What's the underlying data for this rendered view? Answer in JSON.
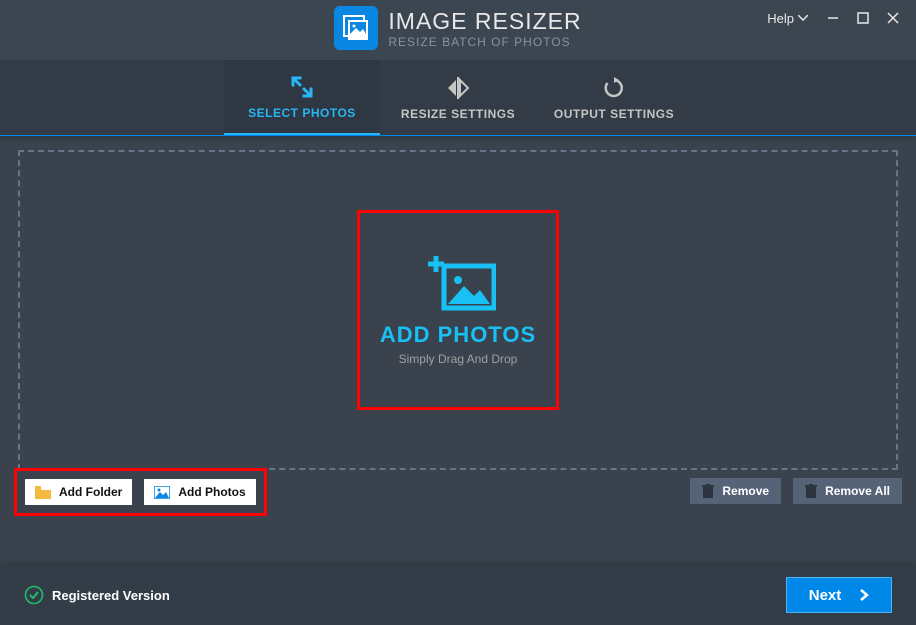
{
  "header": {
    "app_title": "IMAGE RESIZER",
    "app_subtitle": "RESIZE BATCH OF PHOTOS",
    "help_label": "Help"
  },
  "tabs": {
    "select_photos": "SELECT PHOTOS",
    "resize_settings": "RESIZE SETTINGS",
    "output_settings": "OUTPUT SETTINGS"
  },
  "drop": {
    "title": "ADD PHOTOS",
    "subtitle": "Simply Drag And Drop"
  },
  "buttons": {
    "add_folder": "Add Folder",
    "add_photos": "Add Photos",
    "remove": "Remove",
    "remove_all": "Remove All",
    "next": "Next"
  },
  "footer": {
    "registered": "Registered Version"
  },
  "colors": {
    "accent": "#18c0f4",
    "nav_accent": "#28b6f6",
    "primary_button": "#0088e8",
    "highlight": "#fd0202"
  }
}
